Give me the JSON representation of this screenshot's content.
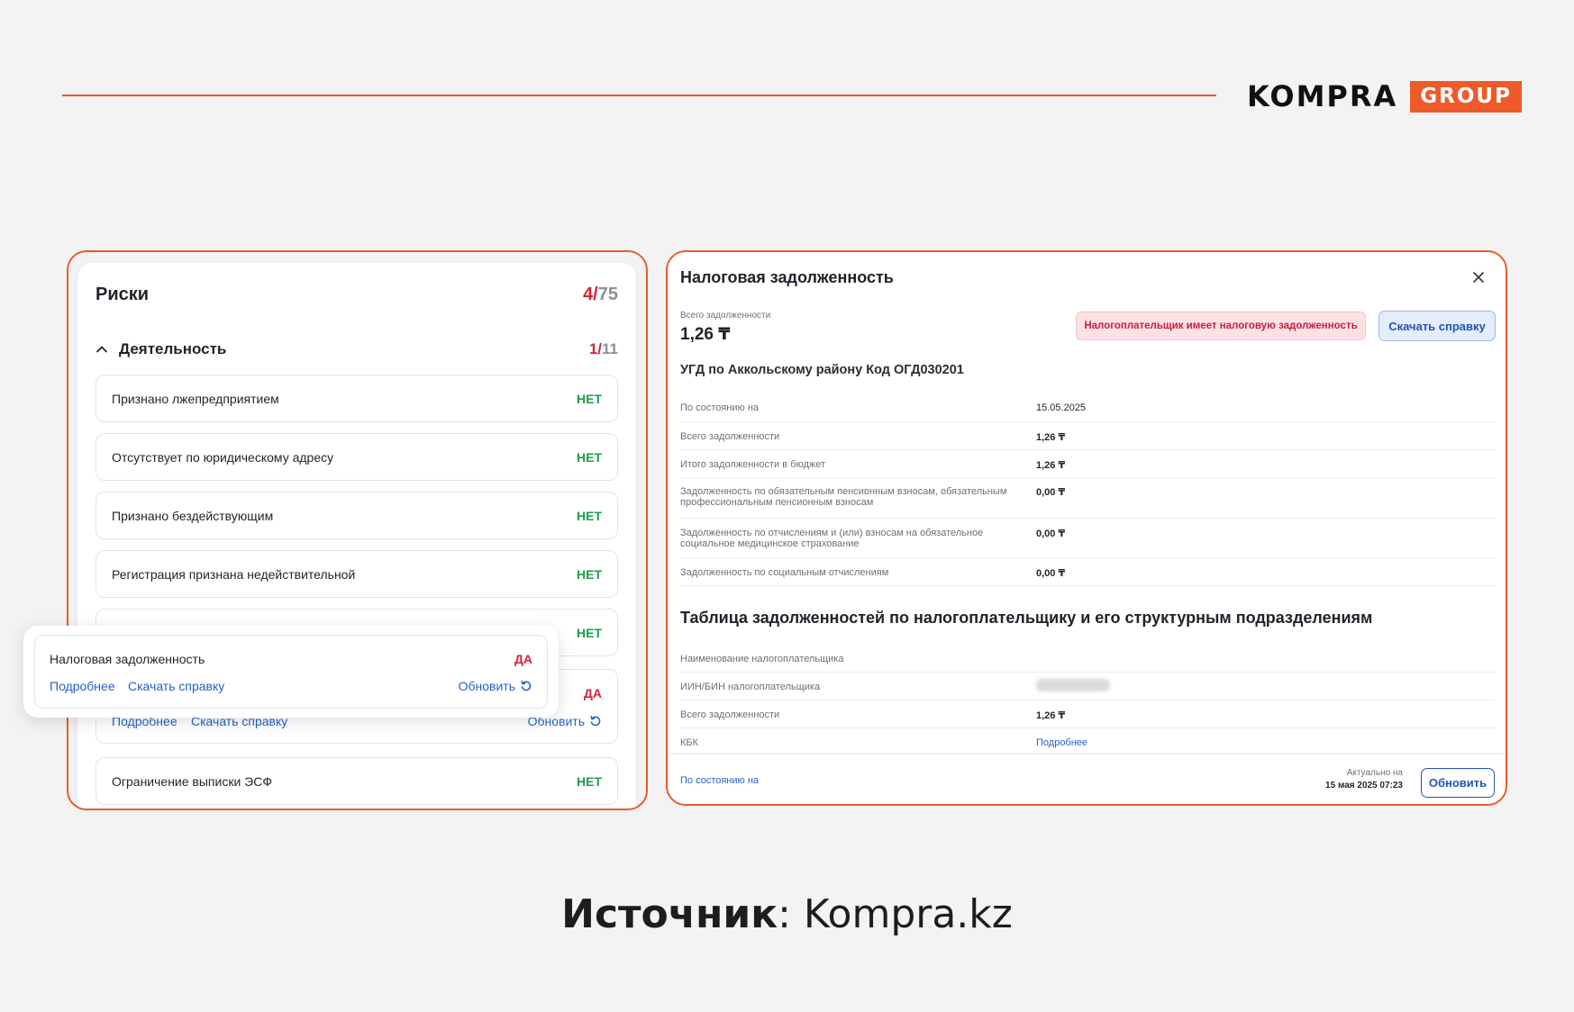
{
  "brand": {
    "word": "KOMPRA",
    "badge": "GROUP",
    "accent": "#ec5a2c"
  },
  "risks": {
    "title": "Риски",
    "count_hit": "4/",
    "count_total": "75",
    "section": {
      "title": "Деятельность",
      "count_hit": "1/",
      "count_total": "11"
    },
    "rows": [
      {
        "label": "Признано лжепредприятием",
        "status": "НЕТ"
      },
      {
        "label": "Отсутствует по юридическому адресу",
        "status": "НЕТ"
      },
      {
        "label": "Признано бездействующим",
        "status": "НЕТ"
      },
      {
        "label": "Регистрация признана недействительной",
        "status": "НЕТ"
      },
      {
        "label": "",
        "status": "НЕТ"
      }
    ],
    "expanded": {
      "status": "ДА",
      "more": "Подробнее",
      "download": "Скачать справку",
      "refresh": "Обновить"
    },
    "last_row": {
      "label": "Ограничение выписки ЭСФ",
      "status": "НЕТ"
    },
    "popup": {
      "label": "Налоговая задолженность",
      "status": "ДА",
      "more": "Подробнее",
      "download": "Скачать справку",
      "refresh": "Обновить"
    }
  },
  "tax": {
    "title": "Налоговая задолженность",
    "total_caption": "Всего задолженности",
    "total_value": "1,26 ₸",
    "badge": "Налогоплательщик имеет налоговую задолженность",
    "download": "Скачать справку",
    "ugd": "УГД по Аккольскому району Код ОГД030201",
    "details": [
      {
        "k": "По состоянию на",
        "v": "15.05.2025"
      },
      {
        "k": "Всего задолженности",
        "v": "1,26 ₸"
      },
      {
        "k": "Итого задолженности в бюджет",
        "v": "1,26 ₸"
      },
      {
        "k": "Задолженность по обязательным пенсионным взносам, обязательным профессиональным пенсионным взносам",
        "v": "0,00 ₸"
      },
      {
        "k": "Задолженность по отчислениям и (или) взносам на обязательное социальное медицинское страхование",
        "v": "0,00 ₸"
      },
      {
        "k": "Задолженность по социальным отчислениям",
        "v": "0,00 ₸"
      }
    ],
    "table_title": "Таблица задолженностей по налогоплательщику и его структурным подразделениям",
    "table_rows": [
      {
        "k": "Наименование налогоплательщика",
        "v": ""
      },
      {
        "k": "ИИН/БИН налогоплательщика",
        "v": ""
      },
      {
        "k": "Всего задолженности",
        "v": "1,26 ₸"
      },
      {
        "k": "КБК",
        "v": "Подробнее"
      }
    ],
    "footer_left": "По состоянию на",
    "actual_caption": "Актуально на",
    "actual_date": "15 мая 2025 07:23",
    "refresh": "Обновить"
  },
  "source": {
    "label": "Источник",
    "value": ": Kompra.kz"
  }
}
